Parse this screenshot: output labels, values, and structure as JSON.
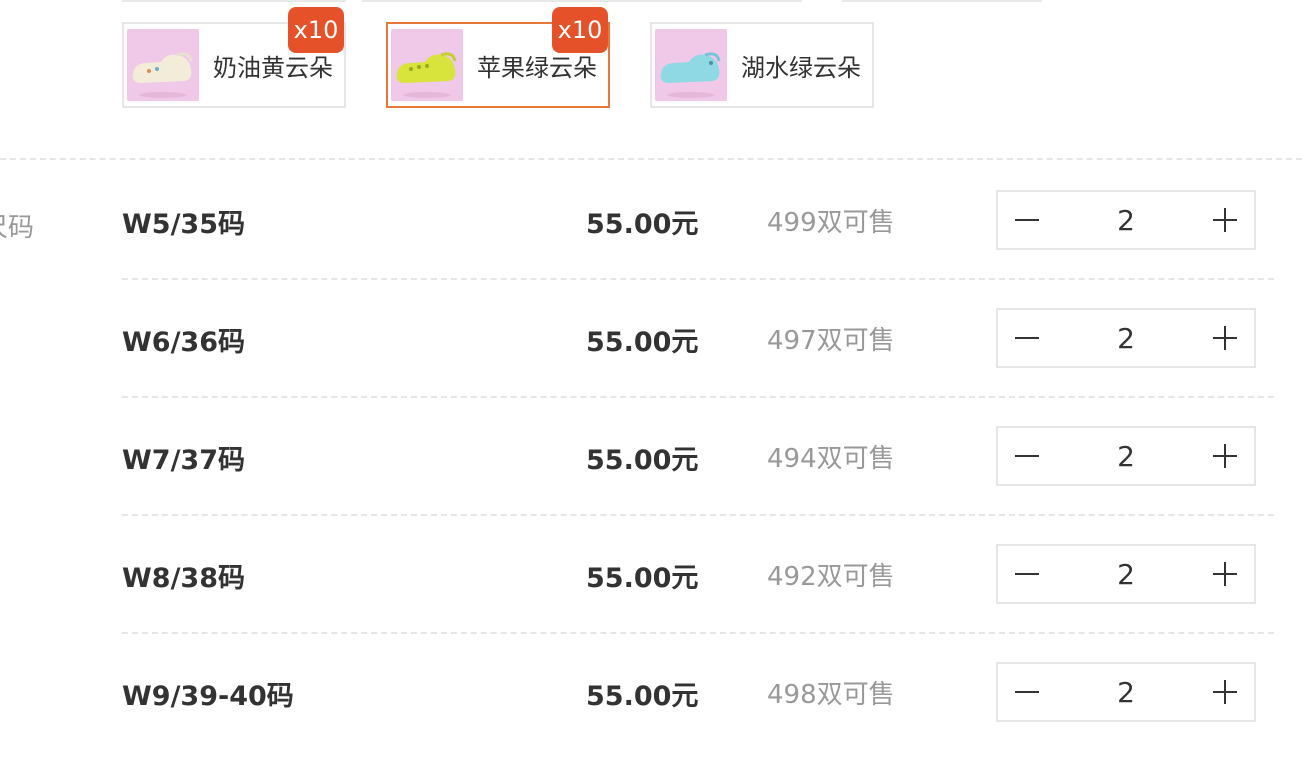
{
  "colors": [
    {
      "label": "奶油黄云朵",
      "badge": "x10",
      "selected": false,
      "shoe_color": "#f3ecd8"
    },
    {
      "label": "苹果绿云朵",
      "badge": "x10",
      "selected": true,
      "shoe_color": "#d8e33c"
    },
    {
      "label": "湖水绿云朵",
      "badge": "",
      "selected": false,
      "shoe_color": "#8ed9e4"
    }
  ],
  "side_label": "尺码",
  "sizes": [
    {
      "name": "W5/35码",
      "price": "55.00元",
      "stock": "499双可售",
      "qty": "2"
    },
    {
      "name": "W6/36码",
      "price": "55.00元",
      "stock": "497双可售",
      "qty": "2"
    },
    {
      "name": "W7/37码",
      "price": "55.00元",
      "stock": "494双可售",
      "qty": "2"
    },
    {
      "name": "W8/38码",
      "price": "55.00元",
      "stock": "492双可售",
      "qty": "2"
    },
    {
      "name": "W9/39-40码",
      "price": "55.00元",
      "stock": "498双可售",
      "qty": "2"
    }
  ],
  "theme": {
    "accent": "#e8773a",
    "badge": "#e5522a",
    "muted_text": "#999999",
    "thumb_background": "#f0c8e8"
  }
}
